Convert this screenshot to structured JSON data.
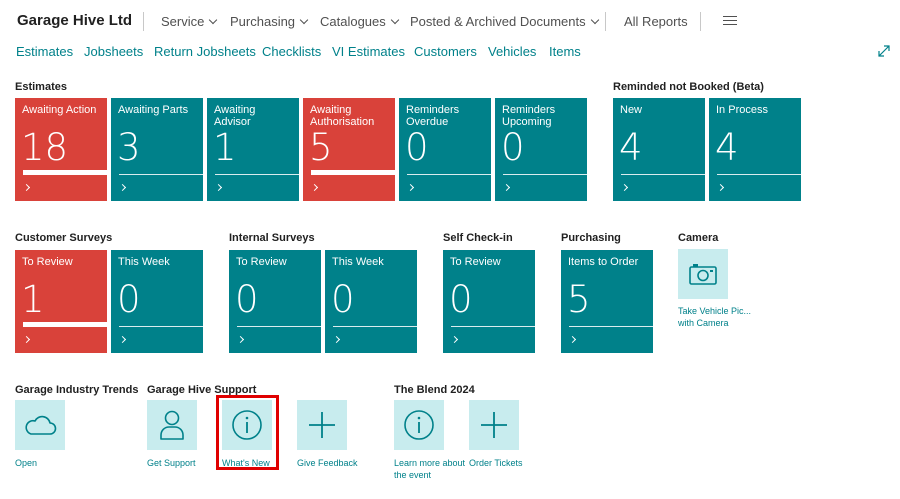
{
  "header": {
    "company": "Garage Hive Ltd",
    "menus": [
      {
        "label": "Service"
      },
      {
        "label": "Purchasing"
      },
      {
        "label": "Catalogues"
      },
      {
        "label": "Posted & Archived Documents"
      }
    ],
    "all_reports": "All Reports",
    "menu_icon": "hamburger-icon"
  },
  "navlinks": [
    "Estimates",
    "Jobsheets",
    "Return Jobsheets",
    "Checklists",
    "VI Estimates",
    "Customers",
    "Vehicles",
    "Items"
  ],
  "expand_icon": "expand-icon",
  "groups": {
    "estimates": {
      "title": "Estimates",
      "tiles": [
        {
          "label": "Awaiting Action",
          "value": "18",
          "alert": true
        },
        {
          "label": "Awaiting Parts",
          "value": "3",
          "alert": false
        },
        {
          "label": "Awaiting Advisor",
          "value": "1",
          "alert": false
        },
        {
          "label": "Awaiting Authorisation",
          "value": "5",
          "alert": true
        },
        {
          "label": "Reminders Overdue",
          "value": "0",
          "alert": false
        },
        {
          "label": "Reminders Upcoming",
          "value": "0",
          "alert": false
        }
      ]
    },
    "reminded": {
      "title": "Reminded not Booked (Beta)",
      "tiles": [
        {
          "label": "New",
          "value": "4",
          "alert": false
        },
        {
          "label": "In Process",
          "value": "4",
          "alert": false
        }
      ]
    },
    "customer_surveys": {
      "title": "Customer Surveys",
      "tiles": [
        {
          "label": "To Review",
          "value": "1",
          "alert": true
        },
        {
          "label": "This Week",
          "value": "0",
          "alert": false
        }
      ]
    },
    "internal_surveys": {
      "title": "Internal Surveys",
      "tiles": [
        {
          "label": "To Review",
          "value": "0",
          "alert": false
        },
        {
          "label": "This Week",
          "value": "0",
          "alert": false
        }
      ]
    },
    "self_checkin": {
      "title": "Self Check-in",
      "tiles": [
        {
          "label": "To Review",
          "value": "0",
          "alert": false
        }
      ]
    },
    "purchasing": {
      "title": "Purchasing",
      "tiles": [
        {
          "label": "Items to Order",
          "value": "5",
          "alert": false
        }
      ]
    },
    "camera": {
      "title": "Camera",
      "action": {
        "label_line1": "Take Vehicle Pic...",
        "label_line2": "with Camera",
        "icon": "camera-icon"
      }
    },
    "trends": {
      "title": "Garage Industry Trends",
      "action": {
        "label": "Open",
        "icon": "cloud-icon"
      }
    },
    "support": {
      "title": "Garage Hive Support",
      "actions": [
        {
          "label": "Get Support",
          "icon": "person-icon"
        },
        {
          "label": "What's New",
          "icon": "info-icon",
          "highlighted": true
        },
        {
          "label": "Give Feedback",
          "icon": "plus-icon"
        }
      ]
    },
    "blend": {
      "title": "The Blend 2024",
      "actions": [
        {
          "label_line1": "Learn more about",
          "label_line2": "the event",
          "icon": "info-icon"
        },
        {
          "label": "Order Tickets",
          "icon": "plus-icon"
        }
      ]
    }
  },
  "colors": {
    "teal": "#00818a",
    "red": "#d9423a",
    "light_teal": "#c8ecee",
    "highlight": "#e00000"
  }
}
